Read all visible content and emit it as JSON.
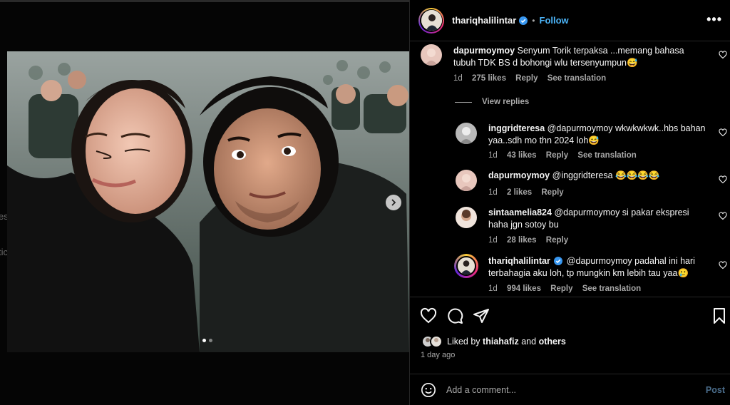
{
  "post": {
    "author": "thariqhalilintar",
    "follow_label": "Follow",
    "separator": "•",
    "more_label": "•••",
    "carousel": {
      "current": 1,
      "total": 2
    }
  },
  "comments": [
    {
      "user": "dapurmoymoy",
      "text": "Senyum Torik terpaksa ...memang bahasa tubuh TDK BS d bohongi wlu tersenyumpun😅",
      "time": "1d",
      "likes": "275 likes",
      "reply": "Reply",
      "translate": "See translation"
    }
  ],
  "view_replies": "View replies",
  "replies": [
    {
      "user": "inggridteresa",
      "text": "@dapurmoymoy wkwkwkwk..hbs bahan yaa..sdh mo thn 2024 loh😅",
      "time": "1d",
      "likes": "43 likes",
      "reply": "Reply",
      "translate": "See translation"
    },
    {
      "user": "dapurmoymoy",
      "text": "@inggridteresa 😂😂😂😂",
      "time": "1d",
      "likes": "2 likes",
      "reply": "Reply"
    },
    {
      "user": "sintaamelia824",
      "text": "@dapurmoymoy si pakar ekspresi haha jgn sotoy bu",
      "time": "1d",
      "likes": "28 likes",
      "reply": "Reply"
    },
    {
      "user": "thariqhalilintar",
      "text": "@dapurmoymoy padahal ini hari terbahagia aku loh, tp mungkin km lebih tau yaa🥲",
      "time": "1d",
      "likes": "994 likes",
      "reply": "Reply",
      "translate": "See translation"
    }
  ],
  "likes_summary": {
    "prefix": "Liked by",
    "user": "thiahafiz",
    "conj": "and",
    "others": "others"
  },
  "time_ago": "1 day ago",
  "add_comment": {
    "placeholder": "Add a comment...",
    "post_label": "Post"
  },
  "backdrop_hints": {
    "top": "l",
    "mid1": "es",
    "mid2": "tic"
  },
  "colors": {
    "accent": "#4cb5f9",
    "verified": "#3897f0",
    "muted": "#a8a8a8",
    "divider": "#262626"
  }
}
